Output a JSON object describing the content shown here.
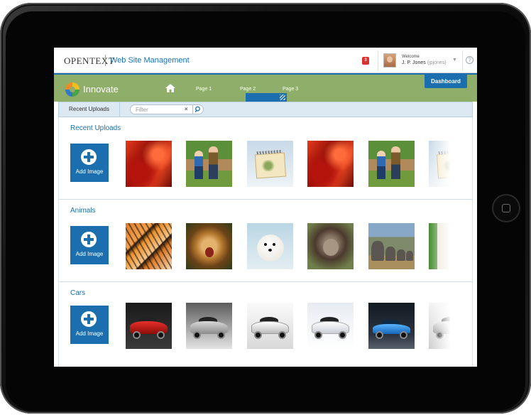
{
  "header": {
    "brand": "OPENTEXT",
    "product": "Web Site Management",
    "notifications_count": "3",
    "welcome_label": "Welcome",
    "user_name": "J. P. Jones",
    "user_id": "(jpjones)",
    "help_label": "?"
  },
  "nav": {
    "site_name": "Innovate",
    "pages": [
      "Page 1",
      "Page 2",
      "Page 3"
    ],
    "active_page": "Page 2",
    "dashboard_label": "Dashboard"
  },
  "toolbar": {
    "recent_uploads_tab": "Recent Uploads",
    "filter_placeholder": "Filter",
    "clear_label": "×"
  },
  "sections": [
    {
      "title": "Recent Uploads",
      "add_label": "Add Image",
      "images": [
        "abstract-red-image",
        "children-image",
        "calendar-image",
        "abstract-red-image",
        "children-image",
        "calendar-image"
      ]
    },
    {
      "title": "Animals",
      "add_label": "Add Image",
      "images": [
        "tigers-image",
        "lion-image",
        "polar-bear-cub-image",
        "chimpanzee-image",
        "elephants-image",
        "giraffe-image"
      ]
    },
    {
      "title": "Cars",
      "add_label": "Add Image",
      "images": [
        "red-sports-car-image",
        "silver-sedan-image",
        "white-coupe-image",
        "white-suv-image",
        "blue-sports-car-image",
        "grey-car-image"
      ]
    }
  ],
  "colors": {
    "accent_blue": "#1b6fae",
    "nav_green": "#8fae6a",
    "badge_red": "#d9322f"
  }
}
